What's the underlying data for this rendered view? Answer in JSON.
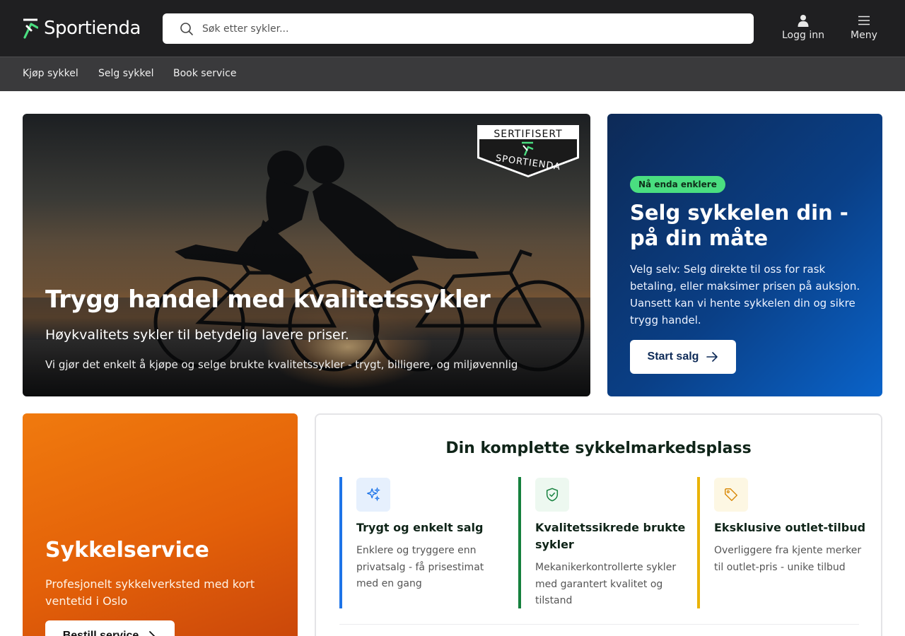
{
  "header": {
    "logo_text": "Sportienda",
    "search_placeholder": "Søk etter sykler...",
    "login_label": "Logg inn",
    "menu_label": "Meny"
  },
  "nav": {
    "items": [
      {
        "label": "Kjøp sykkel"
      },
      {
        "label": "Selg sykkel"
      },
      {
        "label": "Book service"
      }
    ]
  },
  "hero": {
    "badge_top": "SERTIFISERT",
    "badge_bottom": "SPORTIENDA",
    "title": "Trygg handel med kvalitetssykler",
    "subtitle": "Høykvalitets sykler til betydelig lavere priser.",
    "description": "Vi gjør det enkelt å kjøpe og selge brukte kvalitetssykler - trygt, billigere, og miljøvennlig"
  },
  "sell": {
    "badge": "Nå enda enklere",
    "title": "Selg sykkelen din - på din måte",
    "description": "Velg selv: Selg direkte til oss for rask betaling, eller maksimer prisen på auksjon. Uansett kan vi hente sykkelen din og sikre trygg handel.",
    "button": "Start salg"
  },
  "service": {
    "title": "Sykkelservice",
    "description": "Profesjonelt sykkelverksted med kort ventetid i Oslo",
    "button": "Bestill service"
  },
  "market": {
    "title": "Din komplette sykkelmarkedsplass",
    "features": [
      {
        "icon": "sparkles-icon",
        "title": "Trygt og enkelt salg",
        "description": "Enklere og tryggere enn privatsalg - få prisestimat med en gang",
        "color": "#1d74e8"
      },
      {
        "icon": "shield-check-icon",
        "title": "Kvalitetssikrede brukte sykler",
        "description": "Mekanikerkontrollerte sykler med garantert kvalitet og tilstand",
        "color": "#15803d"
      },
      {
        "icon": "tag-icon",
        "title": "Eksklusive outlet-tilbud",
        "description": "Overliggere fra kjente merker til outlet-pris - unike tilbud",
        "color": "#eab308"
      }
    ]
  },
  "colors": {
    "header_bg": "#1f1f21",
    "subnav_bg": "#3a3a3c",
    "accent_green": "#4ade80",
    "sell_blue": "#0a3f86",
    "service_orange": "#e36009"
  }
}
